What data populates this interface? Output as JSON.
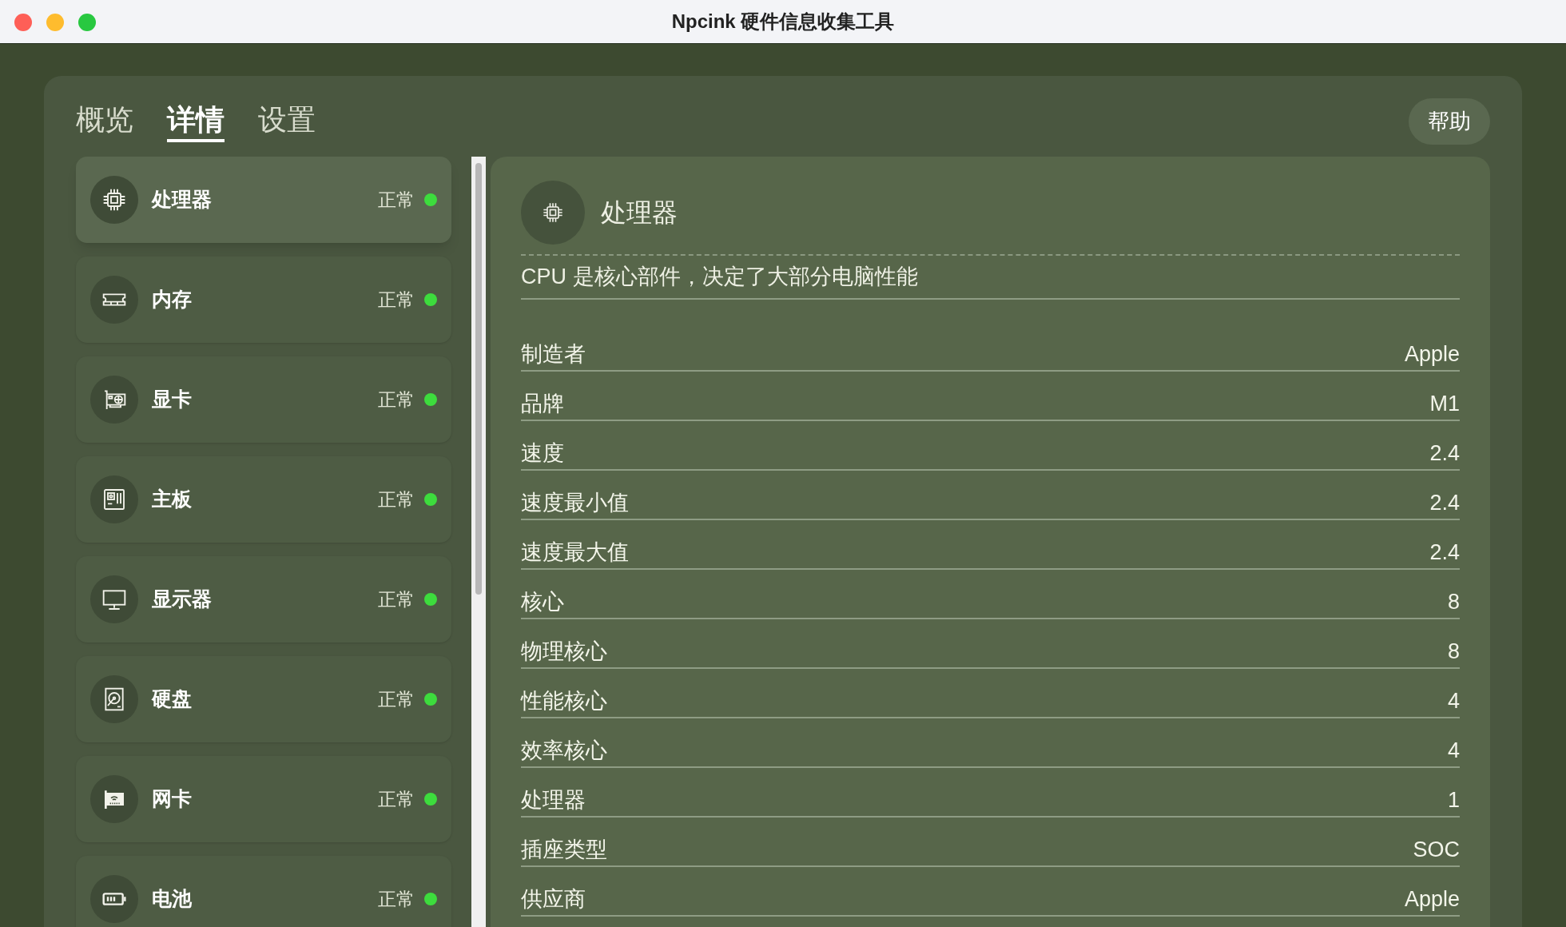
{
  "window": {
    "title": "Npcink 硬件信息收集工具"
  },
  "tabs": [
    {
      "label": "概览",
      "selected": false
    },
    {
      "label": "详情",
      "selected": true
    },
    {
      "label": "设置",
      "selected": false
    }
  ],
  "help_button": "帮助",
  "sidebar": {
    "items": [
      {
        "kind": "cpu",
        "name": "处理器",
        "status": "正常",
        "color": "#3ddc3d",
        "selected": true
      },
      {
        "kind": "memory",
        "name": "内存",
        "status": "正常",
        "color": "#3ddc3d",
        "selected": false
      },
      {
        "kind": "gpu",
        "name": "显卡",
        "status": "正常",
        "color": "#3ddc3d",
        "selected": false
      },
      {
        "kind": "board",
        "name": "主板",
        "status": "正常",
        "color": "#3ddc3d",
        "selected": false
      },
      {
        "kind": "monitor",
        "name": "显示器",
        "status": "正常",
        "color": "#3ddc3d",
        "selected": false
      },
      {
        "kind": "disk",
        "name": "硬盘",
        "status": "正常",
        "color": "#3ddc3d",
        "selected": false
      },
      {
        "kind": "network",
        "name": "网卡",
        "status": "正常",
        "color": "#3ddc3d",
        "selected": false
      },
      {
        "kind": "battery",
        "name": "电池",
        "status": "正常",
        "color": "#3ddc3d",
        "selected": false
      }
    ]
  },
  "detail": {
    "kind": "cpu",
    "title": "处理器",
    "description": "CPU 是核心部件，决定了大部分电脑性能",
    "rows": [
      {
        "label": "制造者",
        "value": "Apple"
      },
      {
        "label": "品牌",
        "value": "M1"
      },
      {
        "label": "速度",
        "value": "2.4"
      },
      {
        "label": "速度最小值",
        "value": "2.4"
      },
      {
        "label": "速度最大值",
        "value": "2.4"
      },
      {
        "label": "核心",
        "value": "8"
      },
      {
        "label": "物理核心",
        "value": "8"
      },
      {
        "label": "性能核心",
        "value": "4"
      },
      {
        "label": "效率核心",
        "value": "4"
      },
      {
        "label": "处理器",
        "value": "1"
      },
      {
        "label": "插座类型",
        "value": "SOC"
      },
      {
        "label": "供应商",
        "value": "Apple"
      }
    ]
  }
}
